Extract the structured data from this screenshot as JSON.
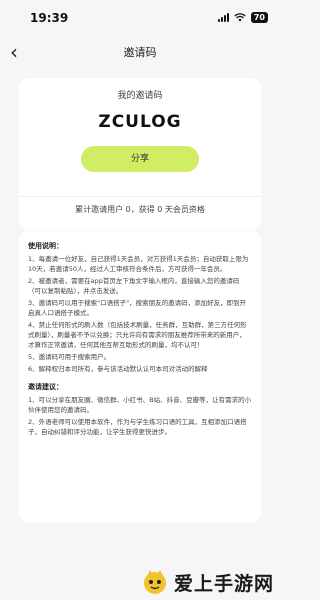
{
  "status_bar": {
    "time": "19:39",
    "battery": "70"
  },
  "nav": {
    "back_glyph": "‹",
    "title": "邀请码"
  },
  "invite": {
    "label": "我的邀请码",
    "code": "ZCULOG",
    "share_label": "分享",
    "stat_text": "累计邀请用户 0，获得 0 天会员资格"
  },
  "rules": {
    "usage_heading": "使用说明：",
    "usage_items": [
      "1、每邀请一位好友，自己获得1天会员，对方获得1天会员；自动获取上限为10天，若邀请50人，经过人工审核符合条件后，方可获得一年会员。",
      "2、被邀请者，需要在app首页左下角文字输入框内，直接输入您的邀请码（可以复制粘贴），并点击发送。",
      "3、邀请码可以用于搜索\"口语搭子\"，搜索朋友的邀请码，添加好友，即到开启真人口语搭子模式。",
      "4、禁止任何形式的刷人数（包括技术刷量，任务群，互助群，第三方任何形式刷量），刷量者不予以兑换；只允许向有需求的朋友推荐所带来的新用户，才算作正常邀请，任何其他互帮互助形式的刷量，均不认可！",
      "5、邀请码可用于搜索用户。",
      "6、解释权归本司所有，参与该活动默认认可本司对活动的解释"
    ],
    "suggest_heading": "邀请建议：",
    "suggest_items": [
      "1、可以分享在朋友圈、微信群、小红书、B站、抖音、豆瓣等，让有需求的小伙伴使用您的邀请码。",
      "2、外语老师可以使用本软件，作为与学生练习口语的工具，互相添加口语搭子，自动纠错和评分功能，让学生获得更快进步。"
    ]
  },
  "watermark": {
    "text": "爱上手游网",
    "icon": "mascot-logo-icon"
  }
}
